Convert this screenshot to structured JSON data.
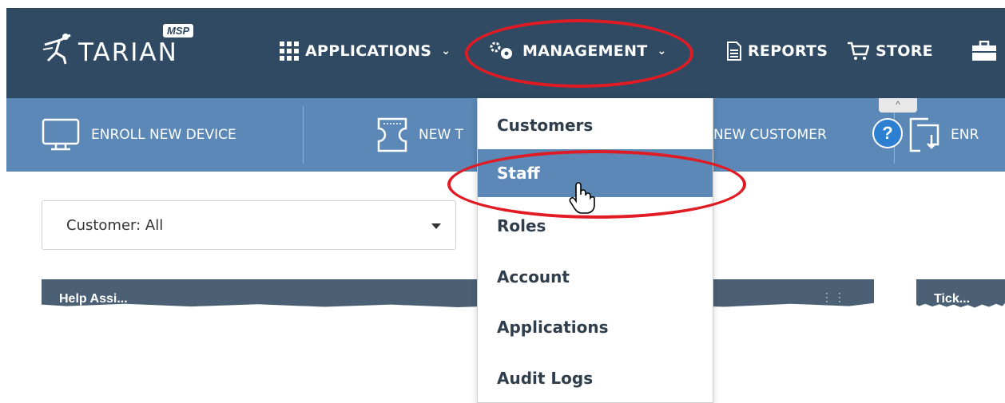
{
  "brand": {
    "logo_text": "TARIAN",
    "logo_badge": "MSP"
  },
  "top_nav": {
    "items": [
      {
        "label": "APPLICATIONS",
        "icon": "grid-icon",
        "has_chevron": true
      },
      {
        "label": "MANAGEMENT",
        "icon": "gears-icon",
        "has_chevron": true
      },
      {
        "label": "REPORTS",
        "icon": "report-icon",
        "has_chevron": false
      },
      {
        "label": "STORE",
        "icon": "cart-icon",
        "has_chevron": false
      }
    ],
    "chevron": "⌄"
  },
  "sub_toolbar": {
    "items": [
      {
        "label": "ENROLL NEW DEVICE",
        "icon": "monitor-icon"
      },
      {
        "label": "NEW T",
        "icon": "ticket-icon"
      },
      {
        "label": "NEW CUSTOMER",
        "icon": "add-customer-icon"
      },
      {
        "label": "ENR",
        "icon": "enroll-download-icon"
      }
    ],
    "help": "?",
    "collapse": "^"
  },
  "filter": {
    "customer_value": "Customer: All"
  },
  "widgets": [
    {
      "title": "Help Assi..."
    },
    {
      "title": "Tick..."
    }
  ],
  "management_menu": {
    "items": [
      {
        "label": "Customers",
        "active": false
      },
      {
        "label": "Staff",
        "active": true
      },
      {
        "label": "Roles",
        "active": false
      },
      {
        "label": "Account",
        "active": false
      },
      {
        "label": "Applications",
        "active": false
      },
      {
        "label": "Audit Logs",
        "active": false
      }
    ]
  },
  "colors": {
    "topbar": "#2f4a62",
    "subbar": "#5b88b6",
    "active_item": "#5b88b6",
    "annotation": "#e01b24"
  }
}
